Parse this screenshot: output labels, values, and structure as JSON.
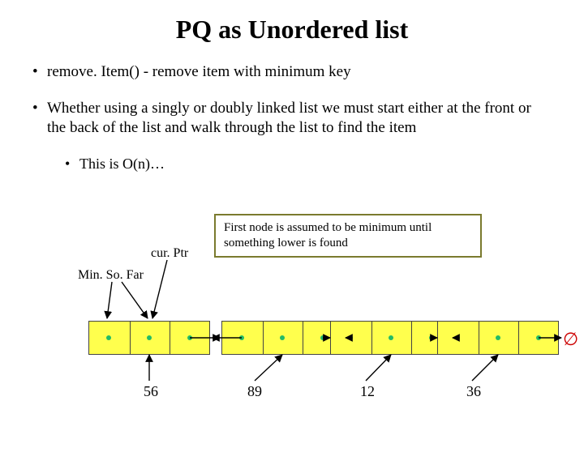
{
  "title": "PQ as Unordered list",
  "bullet1": "remove. Item() - remove item with minimum key",
  "bullet2": "Whether using a singly or doubly linked list we must start either at the front or the back of the list and walk through the list to find the item",
  "bullet3": "This is O(n)…",
  "info": "First node is assumed to be minimum until something lower is found",
  "labels": {
    "cur": "cur. Ptr",
    "min": "Min. So. Far",
    "empty": "∅"
  },
  "nodes": [
    "56",
    "89",
    "12",
    "36"
  ],
  "chart_data": {
    "type": "diagram",
    "structure": "doubly-linked-list",
    "values": [
      56,
      89,
      12,
      36
    ],
    "pointers": {
      "curPtr": 0,
      "minSoFar": 0
    },
    "terminator": "empty-set"
  }
}
